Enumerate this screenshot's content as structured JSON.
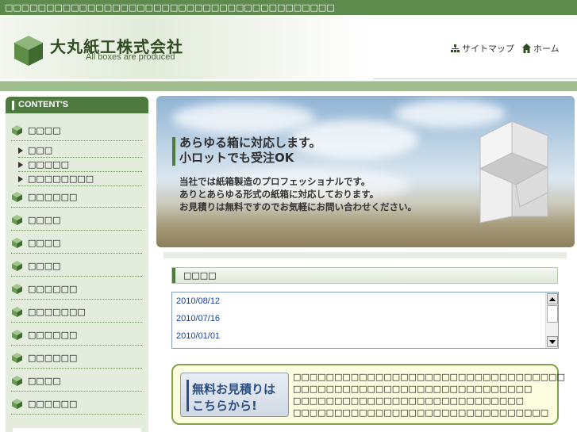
{
  "topbar": {
    "text": "□□□□□□□□□□□□□□□□□□□□□□□□□□□□□□□□□□□□□□□□"
  },
  "header": {
    "company_name": "大丸紙工株式会社",
    "tagline": "All boxes are produced",
    "links": {
      "sitemap": "サイトマップ",
      "home": "ホーム"
    }
  },
  "sidebar": {
    "heading": "CONTENT'S",
    "items": [
      {
        "label": "□□□□"
      },
      {
        "label": "□□□"
      },
      {
        "label": "□□□□□"
      },
      {
        "label": "□□□□□□□□"
      },
      {
        "label": "□□□□□□"
      },
      {
        "label": "□□□□"
      },
      {
        "label": "□□□□"
      },
      {
        "label": "□□□□"
      },
      {
        "label": "□□□□□□"
      },
      {
        "label": "□□□□□□□"
      },
      {
        "label": "□□□□□□"
      },
      {
        "label": "□□□□□□"
      },
      {
        "label": "□□□□"
      },
      {
        "label": "□□□□□□"
      }
    ]
  },
  "banner": {
    "headline_1": "あらゆる箱に対応します。",
    "headline_2": "小ロットでも受注OK",
    "body_1": "当社では紙箱製造のプロフェッショナルです。",
    "body_2": "ありとあらゆる形式の紙箱に対応しております。",
    "body_3": "お見積りは無料ですのでお気軽にお問い合わせください。"
  },
  "news": {
    "heading": "□□□□",
    "items": [
      {
        "date": "2010/08/12"
      },
      {
        "date": "2010/07/16"
      },
      {
        "date": "2010/01/01"
      }
    ]
  },
  "estimate": {
    "button_line1": "無料お見積りは",
    "button_line2": "こちらから!",
    "lines": [
      "□□□□□□□□□□□□□□□□□□□□□□□□□□□□□□□□□",
      "□□□□□□□□□□□□□□□□□□□□□□□□□□□□□",
      "□□□□□□□□□□□□□□□□□□□□□□□□□□□□",
      "□□□□□□□□□□□□□□□□□□□□□□□□□□□□□□□"
    ]
  },
  "colors": {
    "brand_green": "#4f7a3f",
    "topbar": "#5f8a4e",
    "link_blue": "#1a3f9c"
  }
}
